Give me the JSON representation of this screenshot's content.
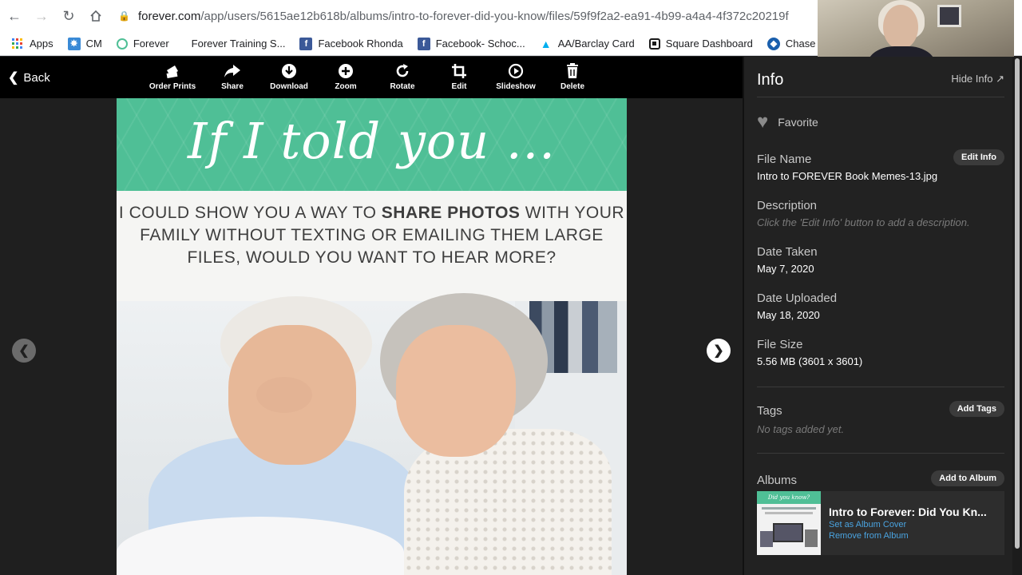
{
  "browser": {
    "url_host": "forever.com",
    "url_path": "/app/users/5615ae12b618b/albums/intro-to-forever-did-you-know/files/59f9f2a2-ea91-4b99-a4a4-4f372c20219f"
  },
  "bookmarks": [
    {
      "label": "Apps",
      "icon": "apps-grid-icon",
      "color": "#4285f4"
    },
    {
      "label": "CM",
      "icon": "cm-icon",
      "color": "#3a8ad6"
    },
    {
      "label": "Forever",
      "icon": "forever-ring-icon",
      "color": "#4fbf96"
    },
    {
      "label": "Forever Training S...",
      "icon": "blank-page-icon",
      "color": "#ffffff"
    },
    {
      "label": "Facebook Rhonda",
      "icon": "facebook-icon",
      "color": "#3b5998"
    },
    {
      "label": "Facebook- Schoc...",
      "icon": "facebook-icon",
      "color": "#3b5998"
    },
    {
      "label": "AA/Barclay Card",
      "icon": "barclay-eagle-icon",
      "color": "#00aeef"
    },
    {
      "label": "Square Dashboard",
      "icon": "square-icon",
      "color": "#1a1a1a"
    },
    {
      "label": "Chase",
      "icon": "chase-icon",
      "color": "#1a5fad"
    }
  ],
  "toolbar": {
    "back_label": "Back",
    "tools": [
      {
        "label": "Order Prints",
        "icon": "order-prints-icon"
      },
      {
        "label": "Share",
        "icon": "share-icon"
      },
      {
        "label": "Download",
        "icon": "download-icon"
      },
      {
        "label": "Zoom",
        "icon": "zoom-icon"
      },
      {
        "label": "Rotate",
        "icon": "rotate-icon"
      },
      {
        "label": "Edit",
        "icon": "crop-icon"
      },
      {
        "label": "Slideshow",
        "icon": "slideshow-icon"
      },
      {
        "label": "Delete",
        "icon": "trash-icon"
      }
    ]
  },
  "photo": {
    "headline": "If I told you ...",
    "message_pre": "I COULD SHOW YOU A WAY TO ",
    "message_bold": "SHARE PHOTOS",
    "message_post": " WITH YOUR FAMILY WITHOUT TEXTING OR EMAILING THEM LARGE FILES, WOULD YOU WANT TO HEAR MORE?",
    "band_color": "#4fbf96"
  },
  "info": {
    "title": "Info",
    "hide_label": "Hide Info",
    "favorite_label": "Favorite",
    "file_name_label": "File Name",
    "file_name": "Intro to FOREVER Book Memes-13.jpg",
    "edit_info_label": "Edit Info",
    "description_label": "Description",
    "description_hint": "Click the 'Edit Info' button to add a description.",
    "date_taken_label": "Date Taken",
    "date_taken": "May 7, 2020",
    "date_uploaded_label": "Date Uploaded",
    "date_uploaded": "May 18, 2020",
    "file_size_label": "File Size",
    "file_size": "5.56 MB (3601 x 3601)",
    "tags_label": "Tags",
    "add_tags_label": "Add Tags",
    "tags_hint": "No tags added yet.",
    "albums_label": "Albums",
    "add_to_album_label": "Add to Album",
    "album": {
      "name": "Intro to Forever: Did You Kn...",
      "thumb_caption": "Did you know?",
      "set_cover_label": "Set as Album Cover",
      "remove_label": "Remove from Album"
    }
  }
}
